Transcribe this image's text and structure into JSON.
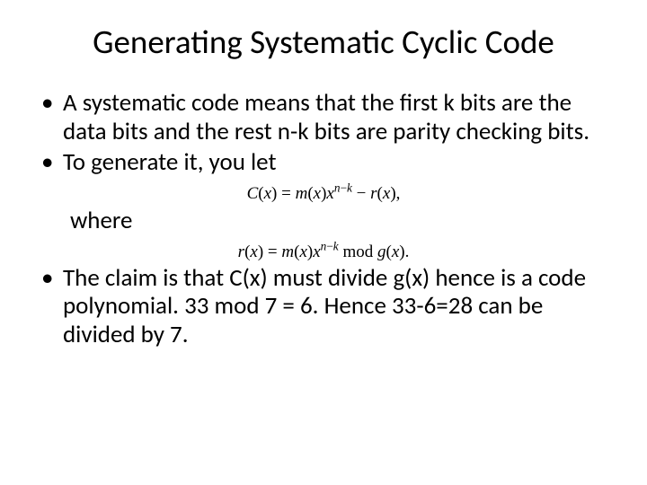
{
  "title": "Generating Systematic Cyclic Code",
  "bullets": {
    "b1": "A systematic code means that the first k bits are the data bits and the rest n-k bits are parity checking bits.",
    "b2": "To generate it, you let",
    "b3": "The claim is that C(x) must divide g(x) hence is a code polynomial. 33 mod 7 = 6. Hence 33-6=28 can be divided by 7."
  },
  "where_label": "where",
  "formulas": {
    "f1_html": "<i>C</i>(<i>x</i>) = <i>m</i>(<i>x</i>)<i>x</i><sup><i>n</i>&minus;<i>k</i></sup> &minus; <i>r</i>(<i>x</i>),",
    "f2_html": "<i>r</i>(<i>x</i>) = <i>m</i>(<i>x</i>)<i>x</i><sup><i>n</i>&minus;<i>k</i></sup> mod <i>g</i>(<i>x</i>)."
  }
}
